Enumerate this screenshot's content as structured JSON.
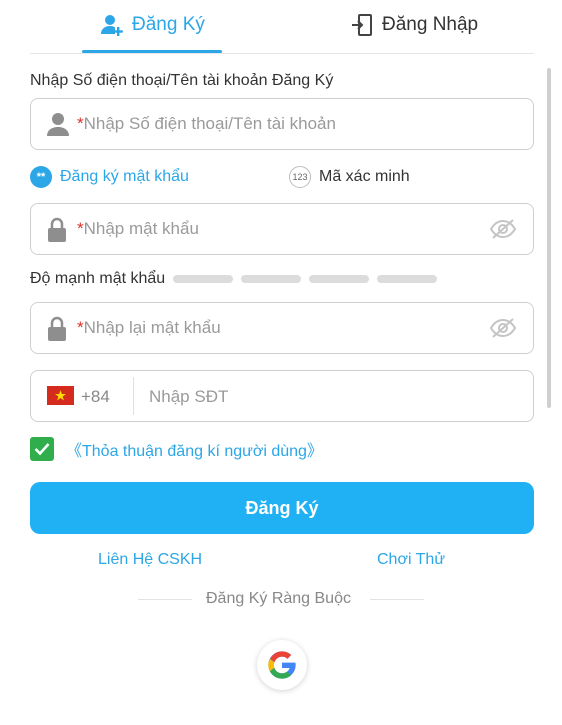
{
  "tabs": {
    "register_label": "Đăng Ký",
    "login_label": "Đăng Nhập"
  },
  "account": {
    "label": "Nhập Số điện thoại/Tên tài khoản Đăng Ký",
    "required_mark": "*",
    "placeholder": "Nhập Số điện thoại/Tên tài khoản"
  },
  "mode": {
    "password_option": "Đăng ký mật khẩu",
    "password_badge": "**",
    "code_option": "Mã xác minh",
    "code_badge": "123",
    "selected": "password"
  },
  "password": {
    "required_mark": "*",
    "placeholder": "Nhập mật khẩu"
  },
  "strength": {
    "label": "Độ mạnh mật khẩu",
    "level": 0,
    "segments": 4
  },
  "confirm": {
    "required_mark": "*",
    "placeholder": "Nhập lại mật khẩu"
  },
  "phone": {
    "country_code": "+84",
    "placeholder": "Nhập SĐT"
  },
  "agreement": {
    "checked": true,
    "text": "《Thỏa thuận đăng kí người dùng》"
  },
  "submit_label": "Đăng Ký",
  "links": {
    "support": "Liên Hệ CSKH",
    "trial": "Chơi Thử"
  },
  "bind_label": "Đăng Ký Ràng Buộc",
  "colors": {
    "accent": "#2ba6e6",
    "button": "#20b1f4",
    "check": "#2fae4b",
    "required": "#e0322b"
  },
  "icons": [
    "add-user-icon",
    "login-icon",
    "user-icon",
    "lock-icon",
    "eye-off-icon",
    "vietnam-flag-icon",
    "check-icon",
    "google-icon"
  ]
}
